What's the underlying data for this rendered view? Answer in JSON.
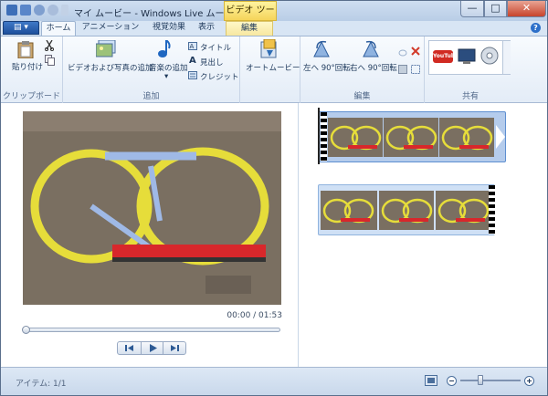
{
  "window": {
    "title": "マイ ムービー - Windows Live ムービー ...",
    "contextual_tab_group": "ビデオ ツール",
    "minimize": "—",
    "maximize": "□",
    "close": "✕"
  },
  "tabs": {
    "file_menu": "▤ ▾",
    "home": "ホーム",
    "animation": "アニメーション",
    "visual_effects": "視覚効果",
    "view": "表示",
    "edit": "編集",
    "help": "?"
  },
  "ribbon": {
    "clipboard": {
      "paste": "貼り付け",
      "group_label": "クリップボード"
    },
    "add": {
      "add_videos_photos": "ビデオおよび写真の追加",
      "add_music": "音楽の追加",
      "music_dropdown": "▾",
      "title": "タイトル",
      "caption": "見出し",
      "credits": "クレジット",
      "group_label": "追加"
    },
    "automovie": {
      "label": "オートムービー"
    },
    "editing": {
      "rotate_left": "左へ 90°回転",
      "rotate_right": "右へ 90°回転",
      "group_label": "編集"
    },
    "share": {
      "youtube": "YouTube",
      "group_label": "共有"
    }
  },
  "preview": {
    "timecode": "00:00 / 01:53",
    "progress": 0.0
  },
  "storyboard": {
    "clip_count": 2
  },
  "status": {
    "items": "アイテム: 1/1"
  },
  "colors": {
    "accent": "#2c6fc9",
    "context_tab": "#f5d45a",
    "close_button": "#c7432b",
    "track_yellow": "#e6dd3a",
    "track_blue": "#9fb9e6",
    "train_red": "#d8272b"
  }
}
